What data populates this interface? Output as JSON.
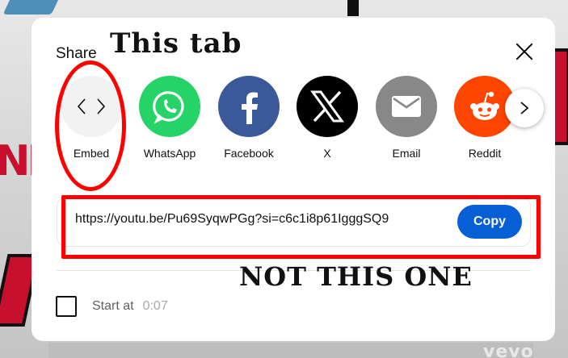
{
  "dialog": {
    "title": "Share",
    "close_label": "close",
    "targets": [
      {
        "label": "Embed",
        "icon": "embed-code-icon",
        "color": "#f2f2f2"
      },
      {
        "label": "WhatsApp",
        "icon": "whatsapp-icon",
        "color": "#25d366"
      },
      {
        "label": "Facebook",
        "icon": "facebook-icon",
        "color": "#3b5998"
      },
      {
        "label": "X",
        "icon": "x-logo-icon",
        "color": "#000000"
      },
      {
        "label": "Email",
        "icon": "email-icon",
        "color": "#888888"
      },
      {
        "label": "Reddit",
        "icon": "reddit-icon",
        "color": "#ff4500"
      }
    ],
    "next_icon": "chevron-right-icon",
    "url": "https://youtu.be/Pu69SyqwPGg?si=c6c1i8p61IgggSQ9",
    "copy_label": "Copy",
    "copy_color": "#065fd4",
    "start_at_label": "Start at",
    "start_at_value": "0:07",
    "start_at_checked": false
  },
  "annotations": {
    "title": "This tab",
    "note": "NOT THIS ONE",
    "color": "#ff0000"
  },
  "background": {
    "watermark": "vevo",
    "partial_text": "NF"
  }
}
